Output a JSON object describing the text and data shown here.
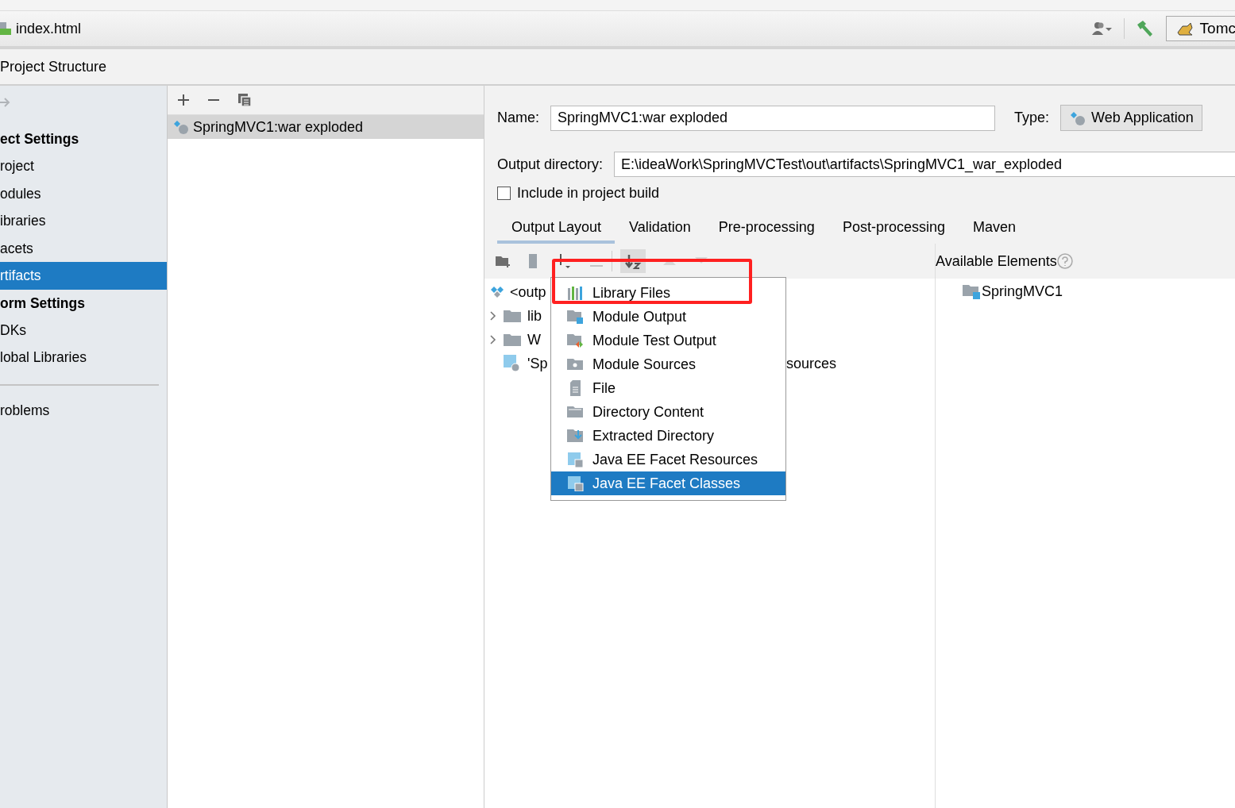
{
  "editor_tab": {
    "title": "index.html"
  },
  "toolbar": {
    "run_config": "Tomc"
  },
  "window": {
    "title": "Project Structure"
  },
  "sidebar": {
    "items": [
      {
        "kind": "header",
        "label": "ect Settings"
      },
      {
        "kind": "item",
        "label": "roject",
        "selected": false
      },
      {
        "kind": "item",
        "label": "odules",
        "selected": false
      },
      {
        "kind": "item",
        "label": "ibraries",
        "selected": false
      },
      {
        "kind": "item",
        "label": "acets",
        "selected": false
      },
      {
        "kind": "item",
        "label": "rtifacts",
        "selected": true
      },
      {
        "kind": "header",
        "label": "orm Settings"
      },
      {
        "kind": "item",
        "label": "DKs",
        "selected": false
      },
      {
        "kind": "item",
        "label": "lobal Libraries",
        "selected": false
      },
      {
        "kind": "separator"
      },
      {
        "kind": "item",
        "label": "roblems",
        "selected": false
      }
    ]
  },
  "artifacts": [
    {
      "label": "SpringMVC1:war exploded",
      "selected": true
    }
  ],
  "form": {
    "name_label": "Name:",
    "name": "SpringMVC1:war exploded",
    "type_label": "Type:",
    "type": "Web Application",
    "output_label": "Output directory:",
    "output": "E:\\ideaWork\\SpringMVCTest\\out\\artifacts\\SpringMVC1_war_exploded",
    "include_label": "Include in project build",
    "include_checked": false
  },
  "tabs": [
    {
      "label": "Output Layout",
      "selected": true
    },
    {
      "label": "Validation",
      "selected": false
    },
    {
      "label": "Pre-processing",
      "selected": false
    },
    {
      "label": "Post-processing",
      "selected": false
    },
    {
      "label": "Maven",
      "selected": false
    }
  ],
  "layout_tree": [
    {
      "kind": "root",
      "text": "<outp",
      "children": [
        {
          "kind": "folder",
          "text": "lib",
          "expanded": false
        },
        {
          "kind": "folder",
          "text": "W",
          "expanded": false
        },
        {
          "kind": "facet",
          "text": "'Sp",
          "text_end": "sources"
        }
      ]
    }
  ],
  "available_elements": {
    "title": "Available Elements",
    "items": [
      {
        "label": "SpringMVC1"
      }
    ]
  },
  "add_menu": [
    {
      "kind": "library",
      "label": "Library Files",
      "selected": false
    },
    {
      "kind": "module",
      "label": "Module Output",
      "selected": false
    },
    {
      "kind": "test",
      "label": "Module Test Output",
      "selected": false
    },
    {
      "kind": "sources",
      "label": "Module Sources",
      "selected": false
    },
    {
      "kind": "file",
      "label": "File",
      "selected": false
    },
    {
      "kind": "dir",
      "label": "Directory Content",
      "selected": false
    },
    {
      "kind": "extract",
      "label": "Extracted Directory",
      "selected": false
    },
    {
      "kind": "javaee",
      "label": "Java EE Facet Resources",
      "selected": false
    },
    {
      "kind": "javaee",
      "label": "Java EE Facet Classes",
      "selected": true
    }
  ]
}
